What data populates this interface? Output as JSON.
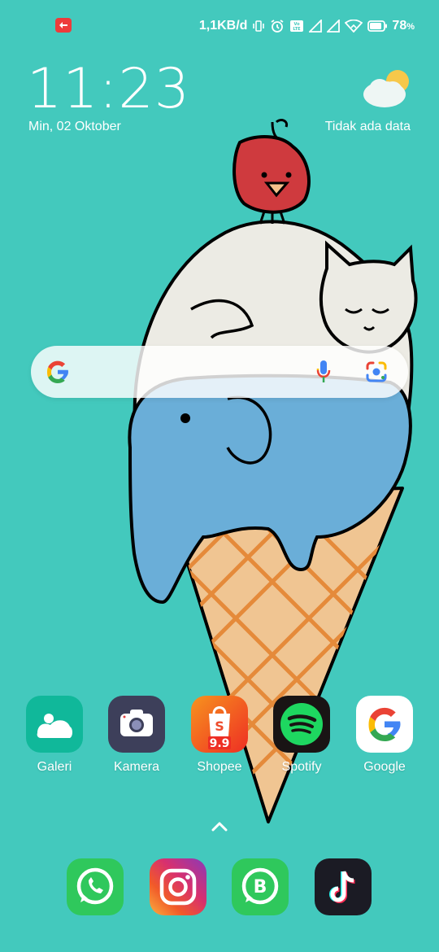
{
  "status_bar": {
    "net_speed": "1,1KB/d",
    "battery": "78",
    "battery_unit": "%",
    "icons": [
      "app-notification-icon",
      "vibrate-icon",
      "alarm-icon",
      "volte-icon",
      "signal-icon",
      "signal-2-icon",
      "wifi-icon",
      "battery-icon"
    ]
  },
  "clock": {
    "time": "11:23",
    "date": "Min, 02 Oktober"
  },
  "weather": {
    "text": "Tidak ada data",
    "icon": "partly-cloudy-icon"
  },
  "search": {
    "icons": [
      "google-g-icon",
      "microphone-icon",
      "google-lens-icon"
    ]
  },
  "apps": [
    {
      "label": "Galeri",
      "icon": "gallery-icon",
      "color": "#10b89a"
    },
    {
      "label": "Kamera",
      "icon": "camera-icon",
      "color": "#3d3f5a"
    },
    {
      "label": "Shopee",
      "icon": "shopee-icon",
      "color": "#f05a28"
    },
    {
      "label": "Spotify",
      "icon": "spotify-icon",
      "color": "#191414"
    },
    {
      "label": "Google",
      "icon": "google-icon",
      "color": "#ffffff"
    }
  ],
  "dock": [
    {
      "name": "whatsapp",
      "icon": "whatsapp-icon",
      "color": "#2fc85c"
    },
    {
      "name": "instagram",
      "icon": "instagram-icon",
      "color": "#d8306e"
    },
    {
      "name": "whatsapp-business",
      "icon": "whatsapp-business-icon",
      "color": "#2fc85c"
    },
    {
      "name": "tiktok",
      "icon": "tiktok-icon",
      "color": "#1b1b24"
    }
  ]
}
